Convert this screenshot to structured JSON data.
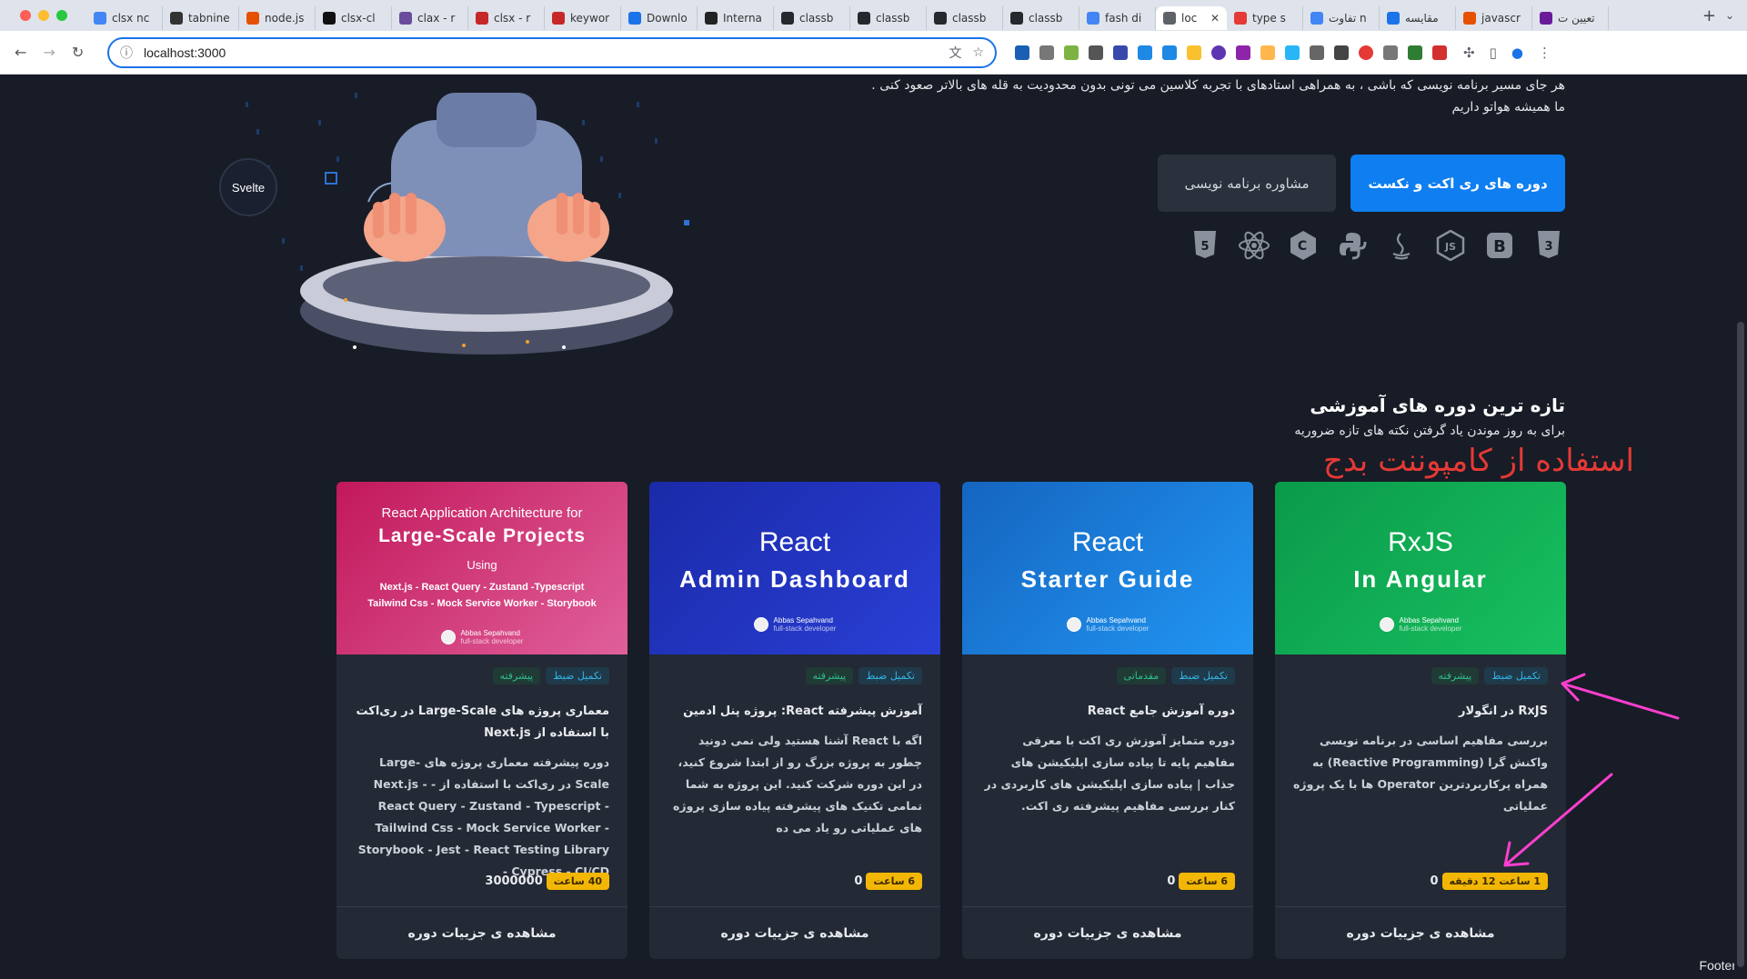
{
  "browser": {
    "tabs": [
      {
        "label": "clsx nc",
        "color": "#4285f4"
      },
      {
        "label": "tabnine",
        "color": "#333333"
      },
      {
        "label": "node.js",
        "color": "#e65100"
      },
      {
        "label": "clsx-cl",
        "color": "#111111"
      },
      {
        "label": "clax - r",
        "color": "#6a4c9c"
      },
      {
        "label": "clsx - r",
        "color": "#c62828"
      },
      {
        "label": "keywor",
        "color": "#c62828"
      },
      {
        "label": "Downlo",
        "color": "#1a73e8"
      },
      {
        "label": "Interna",
        "color": "#222222"
      },
      {
        "label": "classb",
        "color": "#24292e"
      },
      {
        "label": "classb",
        "color": "#24292e"
      },
      {
        "label": "classb",
        "color": "#24292e"
      },
      {
        "label": "classb",
        "color": "#24292e"
      },
      {
        "label": "fash di",
        "color": "#4285f4"
      },
      {
        "label": "loc",
        "color": "#5f6368",
        "active": true
      },
      {
        "label": "type s",
        "color": "#e53935"
      },
      {
        "label": "تفاوت n",
        "color": "#4285f4"
      },
      {
        "label": "مقایسه",
        "color": "#1a73e8"
      },
      {
        "label": "javascr",
        "color": "#e65100"
      },
      {
        "label": "تعیین ت",
        "color": "#6a1b9a"
      }
    ],
    "url": "localhost:3000"
  },
  "hero": {
    "line1": "هر جای مسیر برنامه نویسی که باشی ، به همراهی استادهای با تجربه کلاسین می تونی بدون محدودیت به قله های بالاتر صعود کنی .",
    "line2": "ما همیشه هواتو داریم",
    "primary_button": "دوره های ری اکت و نکست",
    "secondary_button": "مشاوره برنامه نویسی",
    "svelte_label": "Svelte"
  },
  "section": {
    "title": "تازه ترین دوره های آموزشی",
    "subtitle": "برای به روز موندن یاد گرفتن نکته های تازه ضروریه",
    "annotation": "استفاده از کامپوننت بدج"
  },
  "cards": [
    {
      "cover_top": "React Application Architecture for",
      "cover_main": "Large-Scale Projects",
      "cover_using": "Using",
      "cover_tech1": "Next.js - React Query - Zustand -Typescript",
      "cover_tech2": "Tailwind Css - Mock Service Worker - Storybook",
      "author": "Abbas Sepahvand",
      "author_role": "full-stack developer",
      "badge_status": "تکمیل ضبط",
      "badge_level": "پیشرفته",
      "title": "معماری پروژه های Large-Scale در ری‌اکت با استفاده از Next.js",
      "description": "دوره پیشرفته معماری پروژه های Large-Scale در ری‌اکت با استفاده از - Next.js - React Query - Zustand - Typescript - Tailwind Css - Mock Service Worker - Storybook - Jest - React Testing Library - Cypress - CI/CD",
      "duration": "40 ساعت",
      "price": "3000000",
      "details": "مشاهده ی جزییات دوره",
      "color_a": "#c2185b",
      "color_b": "#e0609a"
    },
    {
      "cover_l1": "React",
      "cover_l2": "Admin Dashboard",
      "author": "Abbas Sepahvand",
      "author_role": "full-stack developer",
      "badge_status": "تکمیل ضبط",
      "badge_level": "پیشرفته",
      "title": "آموزش پیشرفته React: پروژه پنل ادمین",
      "description": "اگه با React آشنا هستید ولی نمی دونید چطور به پروژه بزرگ رو از ابتدا شروع کنید، در این دوره شرکت کنید. این پروژه به شما تمامی تکنیک های پیشرفته پیاده سازی پروژه های عملیاتی رو یاد می ده",
      "duration": "6 ساعت",
      "price": "0",
      "details": "مشاهده ی جزییات دوره",
      "color_a": "#1a2aa8",
      "color_b": "#2a3fd6"
    },
    {
      "cover_l1": "React",
      "cover_l2": "Starter Guide",
      "author": "Abbas Sepahvand",
      "author_role": "full-stack developer",
      "badge_status": "تکمیل ضبط",
      "badge_level": "مقدماتی",
      "title": "دوره آموزش جامع React",
      "description": "دوره متمایز آموزش ری اکت با معرفی مفاهیم پایه تا پیاده سازی اپلیکیشن های جذاب | پیاده سازی اپلیکیشن های کاربردی در کنار بررسی مفاهیم پیشرفته ری اکت.",
      "duration": "6 ساعت",
      "price": "0",
      "details": "مشاهده ی جزییات دوره",
      "color_a": "#1565c0",
      "color_b": "#2196f3"
    },
    {
      "cover_l1": "RxJS",
      "cover_l2": "In Angular",
      "author": "Abbas Sepahvand",
      "author_role": "full-stack developer",
      "badge_status": "تکمیل ضبط",
      "badge_level": "پیشرفته",
      "title": "RxJS در انگولار",
      "description": "بررسی مفاهیم اساسی در برنامه نویسی واکنش گرا (Reactive Programming) به همراه پرکاربردترین Operator ها با یک پروژه عملیاتی",
      "duration": "1 ساعت 12 دقیقه",
      "price": "0",
      "details": "مشاهده ی جزییات دوره",
      "color_a": "#0a9a4a",
      "color_b": "#18c060"
    }
  ],
  "footer": {
    "label": "Footer"
  },
  "colors": {
    "page_bg": "#171c26",
    "card_bg": "#232935",
    "primary": "#0e7ef1",
    "annotation_red": "#e53935",
    "annotation_pink": "#ff3fd0"
  }
}
